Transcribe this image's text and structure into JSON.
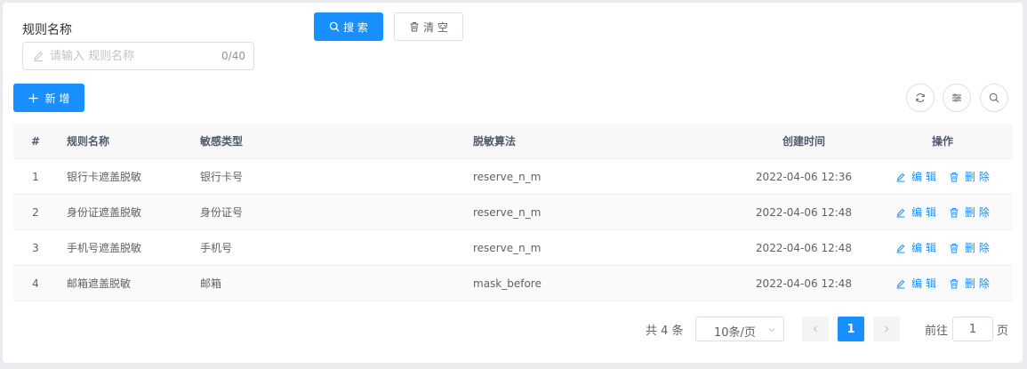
{
  "search_form": {
    "rule_name_label": "规则名称",
    "rule_name_placeholder": "请输入 规则名称",
    "rule_name_value": "",
    "rule_name_counter": "0/40",
    "search_button": "搜 索",
    "clear_button": "清 空"
  },
  "toolbar": {
    "add_button": "新 增",
    "right_icons": [
      "refresh-icon",
      "column-settings-icon",
      "search-icon"
    ]
  },
  "table": {
    "columns": [
      "#",
      "规则名称",
      "敏感类型",
      "脱敏算法",
      "创建时间",
      "操作"
    ],
    "rows": [
      {
        "index": "1",
        "rule_name": "银行卡遮盖脱敏",
        "sensitive_type": "银行卡号",
        "algorithm": "reserve_n_m",
        "created_at": "2022-04-06 12:36"
      },
      {
        "index": "2",
        "rule_name": "身份证遮盖脱敏",
        "sensitive_type": "身份证号",
        "algorithm": "reserve_n_m",
        "created_at": "2022-04-06 12:48"
      },
      {
        "index": "3",
        "rule_name": "手机号遮盖脱敏",
        "sensitive_type": "手机号",
        "algorithm": "reserve_n_m",
        "created_at": "2022-04-06 12:48"
      },
      {
        "index": "4",
        "rule_name": "邮箱遮盖脱敏",
        "sensitive_type": "邮箱",
        "algorithm": "mask_before",
        "created_at": "2022-04-06 12:48"
      }
    ],
    "edit_label": "编 辑",
    "delete_label": "删 除"
  },
  "pagination": {
    "total_text": "共 4 条",
    "page_size": "10条/页",
    "current_page": "1",
    "goto_label": "前往",
    "goto_value": "1",
    "page_suffix": "页"
  },
  "colors": {
    "primary": "#1890ff",
    "header_bg": "#f8f8f9",
    "border": "#dcdfe6"
  }
}
